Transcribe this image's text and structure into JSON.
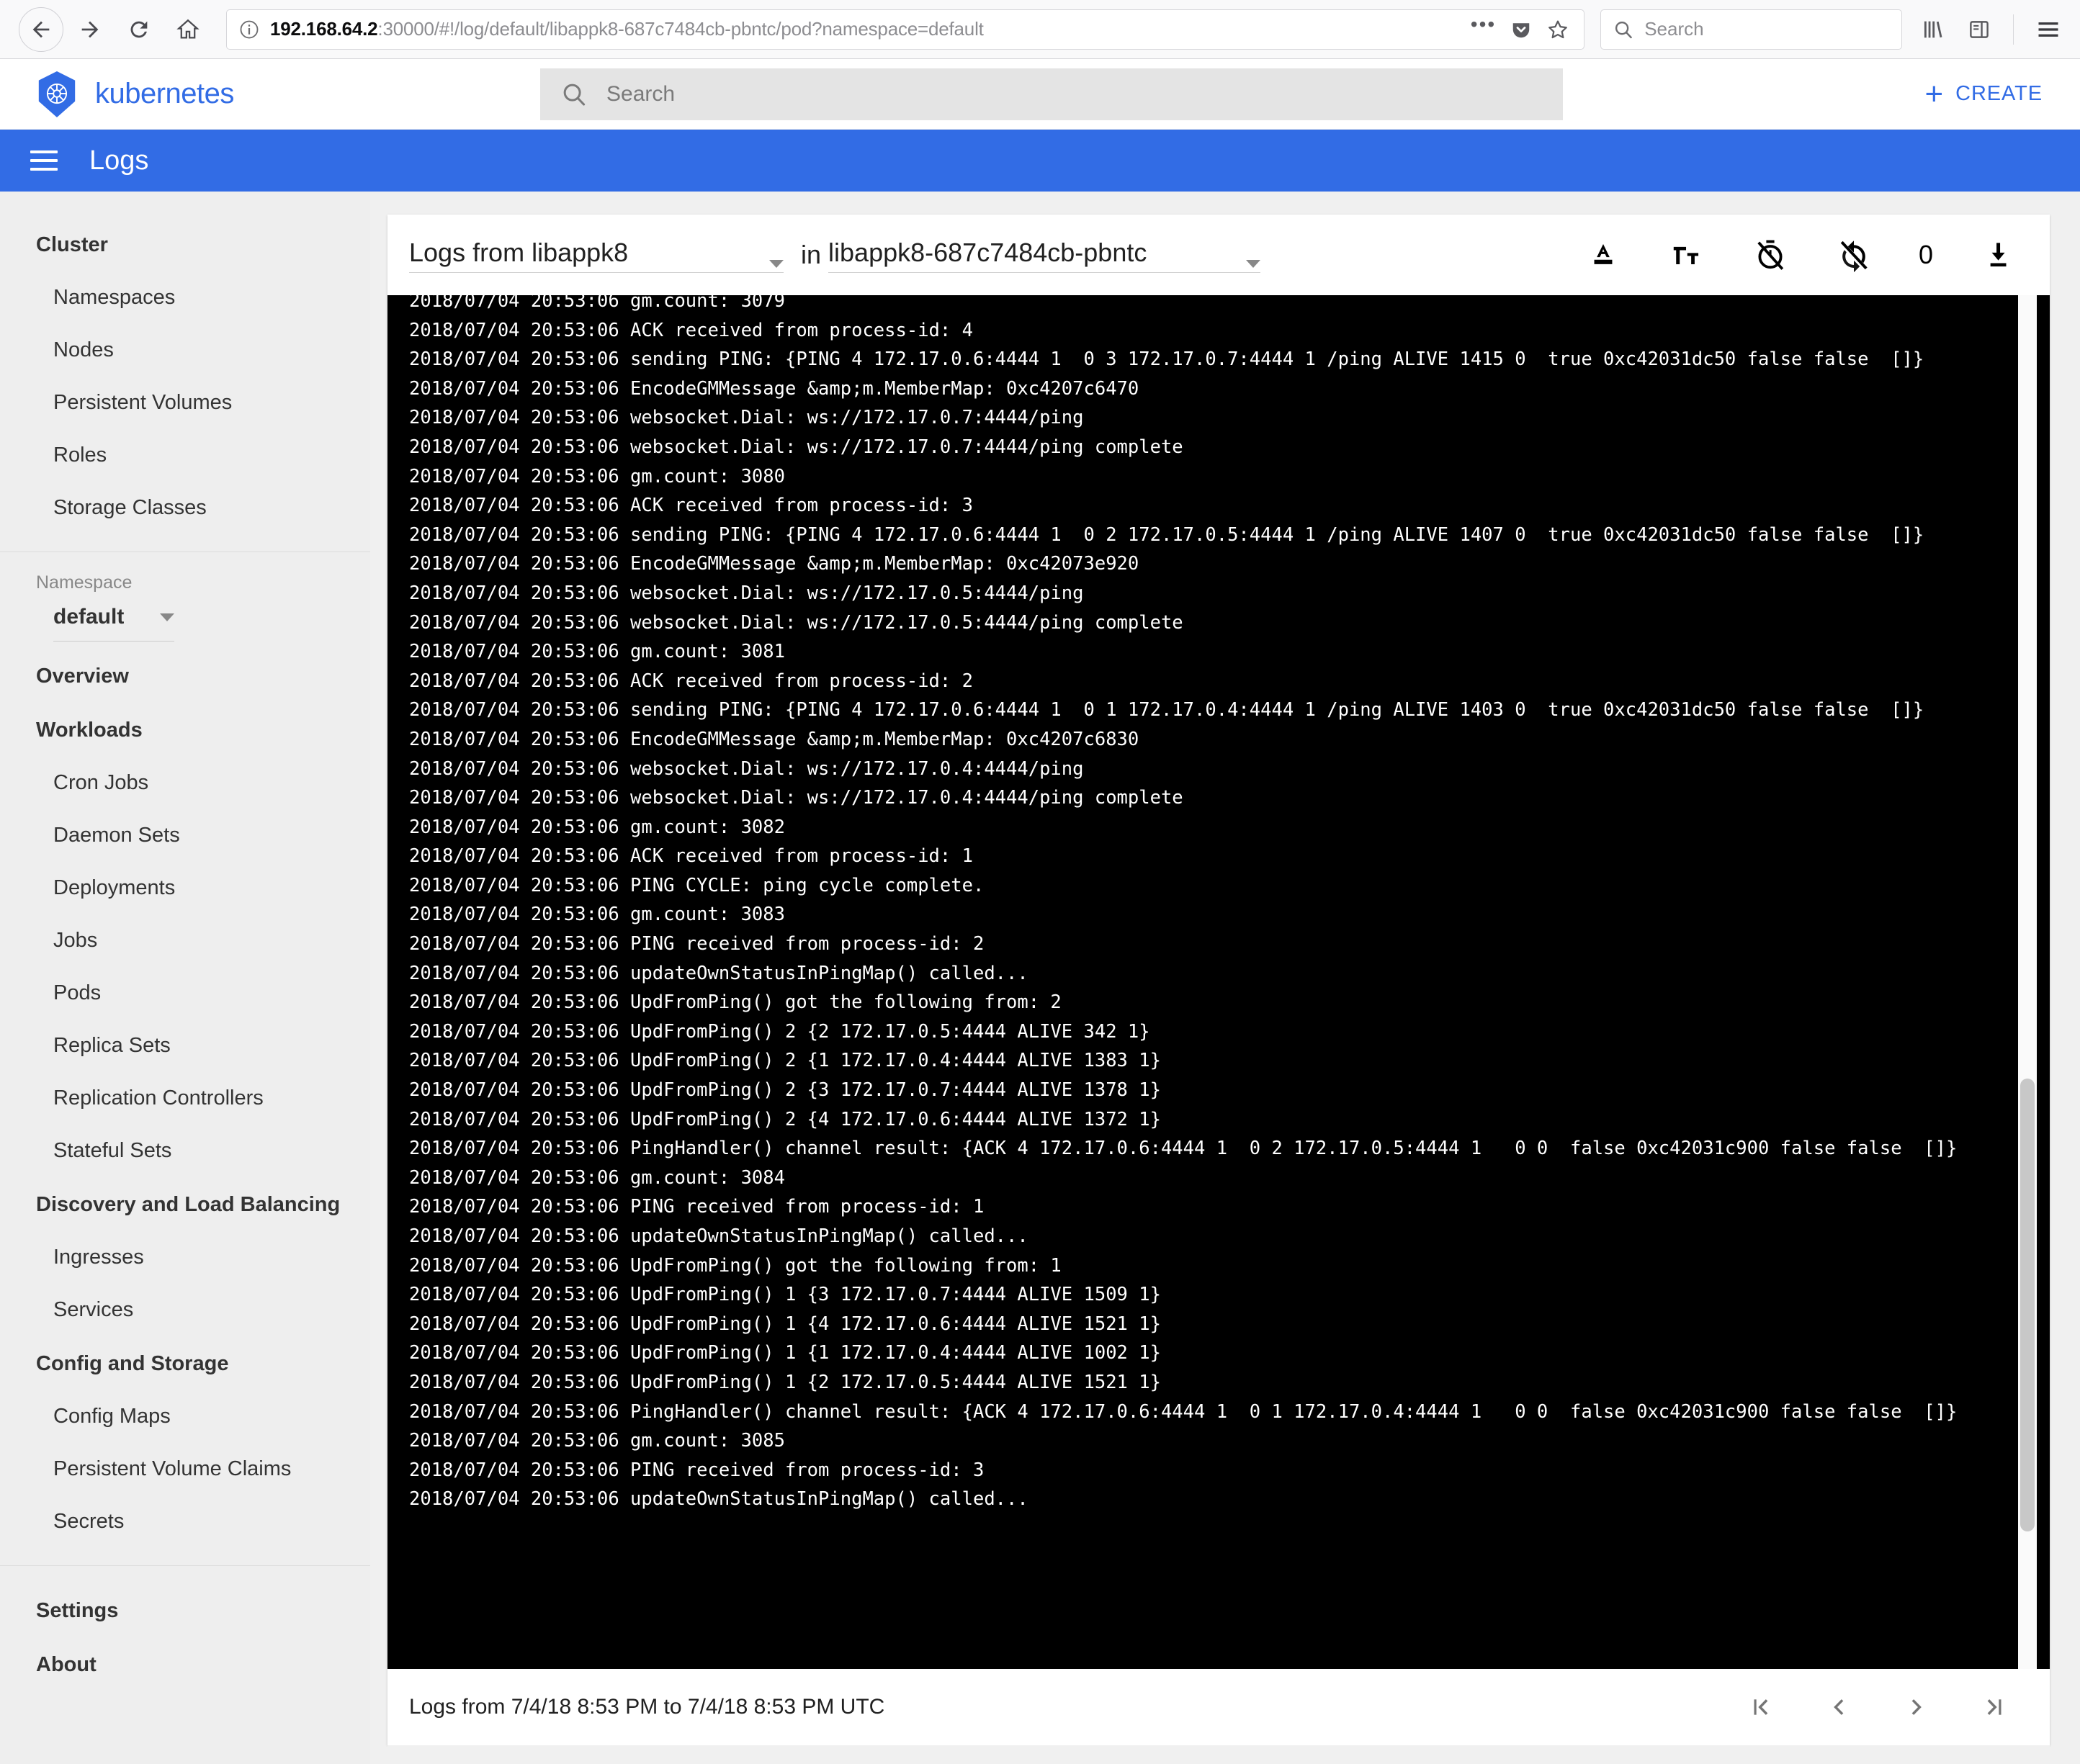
{
  "browser": {
    "url_bold": "192.168.64.2",
    "url_rest": ":30000/#!/log/default/libappk8-687c7484cb-pbntc/pod?namespace=default",
    "search_placeholder": "Search",
    "icons": {
      "back": "back-arrow-icon",
      "forward": "forward-arrow-icon",
      "reload": "reload-icon",
      "home": "home-icon",
      "info": "info-icon",
      "more": "more-options-icon",
      "pocket": "pocket-icon",
      "bookmark": "star-bookmark-icon",
      "library": "library-icon",
      "sidebar": "sidebar-toggle-icon",
      "menu": "app-menu-icon"
    }
  },
  "header": {
    "brand": "kubernetes",
    "search_placeholder": "Search",
    "create_label": "CREATE"
  },
  "toolbar": {
    "title": "Logs"
  },
  "sidebar": {
    "groups": [
      {
        "title": "Cluster",
        "items": [
          "Namespaces",
          "Nodes",
          "Persistent Volumes",
          "Roles",
          "Storage Classes"
        ]
      }
    ],
    "namespace_label": "Namespace",
    "namespace_value": "default",
    "overview": "Overview",
    "workloads": {
      "title": "Workloads",
      "items": [
        "Cron Jobs",
        "Daemon Sets",
        "Deployments",
        "Jobs",
        "Pods",
        "Replica Sets",
        "Replication Controllers",
        "Stateful Sets"
      ]
    },
    "discovery": {
      "title": "Discovery and Load Balancing",
      "items": [
        "Ingresses",
        "Services"
      ]
    },
    "config": {
      "title": "Config and Storage",
      "items": [
        "Config Maps",
        "Persistent Volume Claims",
        "Secrets"
      ]
    },
    "settings": "Settings",
    "about": "About"
  },
  "logs": {
    "container_select": "Logs from libappk8",
    "in_prefix": "in",
    "pod_select": "libappk8-687c7484cb-pbntc",
    "icon_names": [
      "text-color-icon",
      "font-size-icon",
      "timer-off-icon",
      "autorenew-off-icon",
      "download-icon"
    ],
    "count": "0",
    "footer_range": "Logs from 7/4/18 8:53 PM to 7/4/18 8:53 PM UTC",
    "pager": {
      "first": "first-page-icon",
      "prev": "previous-page-icon",
      "next": "next-page-icon",
      "last": "last-page-icon"
    },
    "content": "2018/07/04 20:53:06 gm.count: 3079\n2018/07/04 20:53:06 ACK received from process-id: 4\n2018/07/04 20:53:06 sending PING: {PING 4 172.17.0.6:4444 1  0 3 172.17.0.7:4444 1 /ping ALIVE 1415 0  true 0xc42031dc50 false false  []}\n2018/07/04 20:53:06 EncodeGMMessage &amp;m.MemberMap: 0xc4207c6470\n2018/07/04 20:53:06 websocket.Dial: ws://172.17.0.7:4444/ping\n2018/07/04 20:53:06 websocket.Dial: ws://172.17.0.7:4444/ping complete\n2018/07/04 20:53:06 gm.count: 3080\n2018/07/04 20:53:06 ACK received from process-id: 3\n2018/07/04 20:53:06 sending PING: {PING 4 172.17.0.6:4444 1  0 2 172.17.0.5:4444 1 /ping ALIVE 1407 0  true 0xc42031dc50 false false  []}\n2018/07/04 20:53:06 EncodeGMMessage &amp;m.MemberMap: 0xc42073e920\n2018/07/04 20:53:06 websocket.Dial: ws://172.17.0.5:4444/ping\n2018/07/04 20:53:06 websocket.Dial: ws://172.17.0.5:4444/ping complete\n2018/07/04 20:53:06 gm.count: 3081\n2018/07/04 20:53:06 ACK received from process-id: 2\n2018/07/04 20:53:06 sending PING: {PING 4 172.17.0.6:4444 1  0 1 172.17.0.4:4444 1 /ping ALIVE 1403 0  true 0xc42031dc50 false false  []}\n2018/07/04 20:53:06 EncodeGMMessage &amp;m.MemberMap: 0xc4207c6830\n2018/07/04 20:53:06 websocket.Dial: ws://172.17.0.4:4444/ping\n2018/07/04 20:53:06 websocket.Dial: ws://172.17.0.4:4444/ping complete\n2018/07/04 20:53:06 gm.count: 3082\n2018/07/04 20:53:06 ACK received from process-id: 1\n2018/07/04 20:53:06 PING CYCLE: ping cycle complete.\n2018/07/04 20:53:06 gm.count: 3083\n2018/07/04 20:53:06 PING received from process-id: 2\n2018/07/04 20:53:06 updateOwnStatusInPingMap() called...\n2018/07/04 20:53:06 UpdFromPing() got the following from: 2\n2018/07/04 20:53:06 UpdFromPing() 2 {2 172.17.0.5:4444 ALIVE 342 1}\n2018/07/04 20:53:06 UpdFromPing() 2 {1 172.17.0.4:4444 ALIVE 1383 1}\n2018/07/04 20:53:06 UpdFromPing() 2 {3 172.17.0.7:4444 ALIVE 1378 1}\n2018/07/04 20:53:06 UpdFromPing() 2 {4 172.17.0.6:4444 ALIVE 1372 1}\n2018/07/04 20:53:06 PingHandler() channel result: {ACK 4 172.17.0.6:4444 1  0 2 172.17.0.5:4444 1   0 0  false 0xc42031c900 false false  []}\n2018/07/04 20:53:06 gm.count: 3084\n2018/07/04 20:53:06 PING received from process-id: 1\n2018/07/04 20:53:06 updateOwnStatusInPingMap() called...\n2018/07/04 20:53:06 UpdFromPing() got the following from: 1\n2018/07/04 20:53:06 UpdFromPing() 1 {3 172.17.0.7:4444 ALIVE 1509 1}\n2018/07/04 20:53:06 UpdFromPing() 1 {4 172.17.0.6:4444 ALIVE 1521 1}\n2018/07/04 20:53:06 UpdFromPing() 1 {1 172.17.0.4:4444 ALIVE 1002 1}\n2018/07/04 20:53:06 UpdFromPing() 1 {2 172.17.0.5:4444 ALIVE 1521 1}\n2018/07/04 20:53:06 PingHandler() channel result: {ACK 4 172.17.0.6:4444 1  0 1 172.17.0.4:4444 1   0 0  false 0xc42031c900 false false  []}\n2018/07/04 20:53:06 gm.count: 3085\n2018/07/04 20:53:06 PING received from process-id: 3\n2018/07/04 20:53:06 updateOwnStatusInPingMap() called..."
  },
  "colors": {
    "k8s_blue": "#326ce5",
    "console_bg": "#000000",
    "console_fg": "#ffffff",
    "sidebar_bg": "#eeeeee"
  }
}
